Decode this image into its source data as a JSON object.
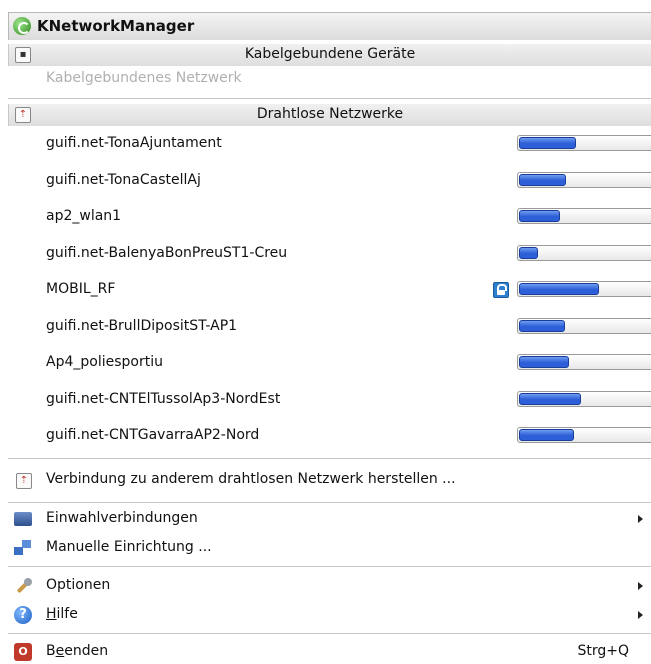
{
  "title": "KNetworkManager",
  "wired": {
    "header": "Kabelgebundene Geräte",
    "network": "Kabelgebundenes Netzwerk"
  },
  "wireless": {
    "header": "Drahtlose Netzwerke",
    "networks": [
      {
        "name": "guifi.net-TonaAjuntament",
        "signal": 0.41,
        "secured": false
      },
      {
        "name": "guifi.net-TonaCastellAj",
        "signal": 0.34,
        "secured": false
      },
      {
        "name": "ap2_wlan1",
        "signal": 0.3,
        "secured": false
      },
      {
        "name": "guifi.net-BalenyaBonPreuST1-Creu",
        "signal": 0.14,
        "secured": false
      },
      {
        "name": "MOBIL_RF",
        "signal": 0.58,
        "secured": true
      },
      {
        "name": "guifi.net-BrullDipositST-AP1",
        "signal": 0.33,
        "secured": false
      },
      {
        "name": "Ap4_poliesportiu",
        "signal": 0.36,
        "secured": false
      },
      {
        "name": "guifi.net-CNTElTussolAp3-NordEst",
        "signal": 0.45,
        "secured": false
      },
      {
        "name": "guifi.net-CNTGavarraAP2-Nord",
        "signal": 0.4,
        "secured": false
      }
    ],
    "connect_other": "Verbindung zu anderem drahtlosen Netzwerk herstellen ..."
  },
  "menu": {
    "dialup": "Einwahlverbindungen",
    "manual": "Manuelle Einrichtung ...",
    "options": "Optionen",
    "help_underlined": "H",
    "help_rest": "ilfe",
    "quit_prefix": "B",
    "quit_underlined": "e",
    "quit_rest": "enden",
    "quit_shortcut": "Strg+Q"
  },
  "colors": {
    "signal_fill": "#2c5fd8",
    "lock": "#2f7fd0",
    "quit_icon": "#c0392b"
  },
  "icons": {
    "title": "knetworkmanager-icon",
    "wired": "wired-device-icon",
    "wireless": "wireless-icon",
    "dialup": "dialup-icon",
    "manual": "network-config-icon",
    "options": "options-icon",
    "help": "help-icon",
    "quit": "quit-icon"
  }
}
